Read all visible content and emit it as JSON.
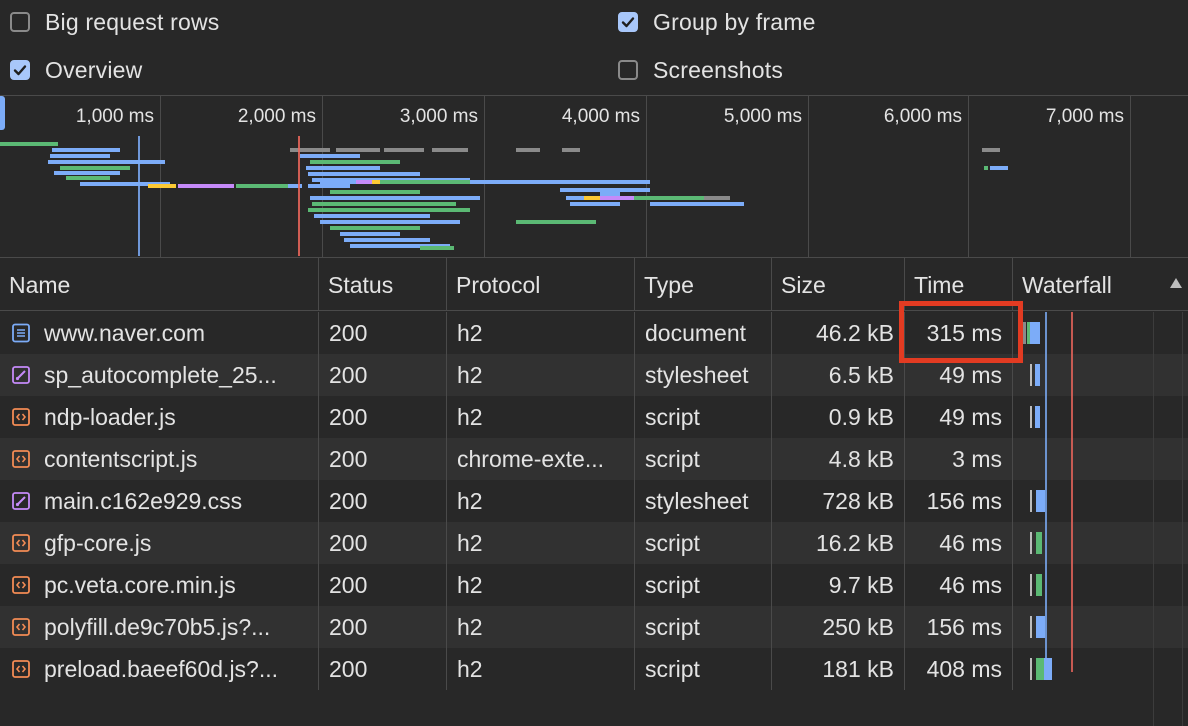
{
  "settings": {
    "big_request_rows": {
      "label": "Big request rows",
      "checked": false
    },
    "group_by_frame": {
      "label": "Group by frame",
      "checked": true
    },
    "overview": {
      "label": "Overview",
      "checked": true
    },
    "screenshots": {
      "label": "Screenshots",
      "checked": false
    }
  },
  "overview": {
    "ticks": [
      "1,000 ms",
      "2,000 ms",
      "3,000 ms",
      "4,000 ms",
      "5,000 ms",
      "6,000 ms",
      "7,000 ms"
    ],
    "colors": {
      "document": "#7cacf8",
      "script": "#5bb974",
      "style": "#c58af9",
      "image": "#fcc934",
      "other": "#8a8a8a",
      "domcontent": "#7cacf8",
      "load": "#ee675c"
    }
  },
  "table": {
    "headers": {
      "name": "Name",
      "status": "Status",
      "protocol": "Protocol",
      "type": "Type",
      "size": "Size",
      "time": "Time",
      "waterfall": "Waterfall"
    },
    "rows": [
      {
        "icon": "document-icon",
        "name": "www.naver.com",
        "status": "200",
        "protocol": "h2",
        "type": "document",
        "size": "46.2 kB",
        "time": "315 ms"
      },
      {
        "icon": "stylesheet-icon",
        "name": "sp_autocomplete_25...",
        "status": "200",
        "protocol": "h2",
        "type": "stylesheet",
        "size": "6.5 kB",
        "time": "49 ms"
      },
      {
        "icon": "script-icon",
        "name": "ndp-loader.js",
        "status": "200",
        "protocol": "h2",
        "type": "script",
        "size": "0.9 kB",
        "time": "49 ms"
      },
      {
        "icon": "script-icon",
        "name": "contentscript.js",
        "status": "200",
        "protocol": "chrome-exte...",
        "type": "script",
        "size": "4.8 kB",
        "time": "3 ms"
      },
      {
        "icon": "stylesheet-icon",
        "name": "main.c162e929.css",
        "status": "200",
        "protocol": "h2",
        "type": "stylesheet",
        "size": "728 kB",
        "time": "156 ms"
      },
      {
        "icon": "script-icon",
        "name": "gfp-core.js",
        "status": "200",
        "protocol": "h2",
        "type": "script",
        "size": "16.2 kB",
        "time": "46 ms"
      },
      {
        "icon": "script-icon",
        "name": "pc.veta.core.min.js",
        "status": "200",
        "protocol": "h2",
        "type": "script",
        "size": "9.7 kB",
        "time": "46 ms"
      },
      {
        "icon": "script-icon",
        "name": "polyfill.de9c70b5.js?...",
        "status": "200",
        "protocol": "h2",
        "type": "script",
        "size": "250 kB",
        "time": "156 ms"
      },
      {
        "icon": "script-icon",
        "name": "preload.baeef60d.js?...",
        "status": "200",
        "protocol": "h2",
        "type": "script",
        "size": "181 kB",
        "time": "408 ms"
      }
    ]
  },
  "colors": {
    "background": "#282828",
    "row_alt": "#313131",
    "highlight": "#e23b22",
    "checkbox_on": "#a8c7fa",
    "stylesheet_icon": "#c58af9",
    "script_icon": "#f28b54",
    "document_icon": "#7cacf8"
  }
}
